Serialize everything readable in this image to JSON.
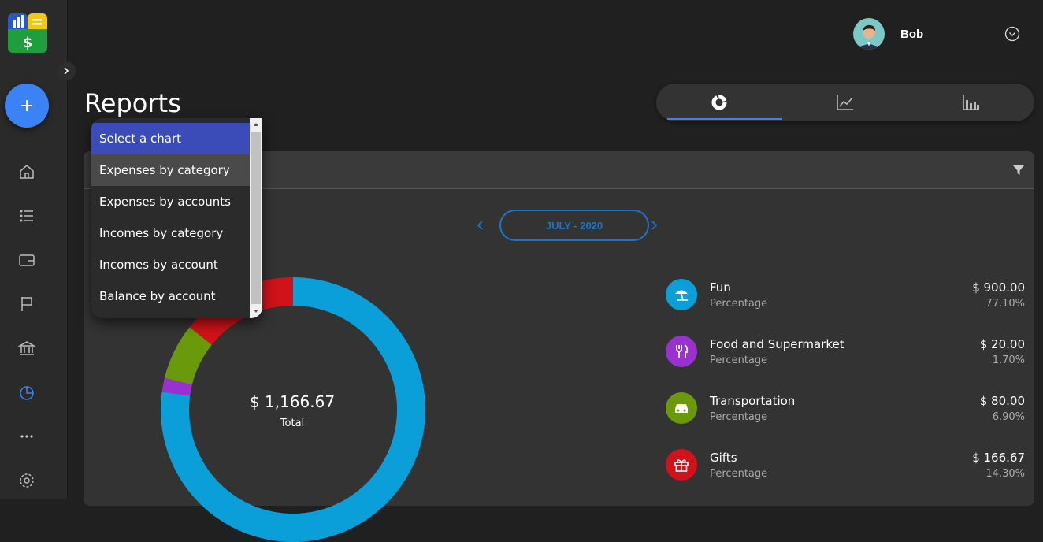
{
  "user": {
    "name": "Bob"
  },
  "page": {
    "title": "Reports"
  },
  "month": {
    "label": "JULY - 2020"
  },
  "total": {
    "amount": "$ 1,166.67",
    "label": "Total"
  },
  "dropdown": {
    "options": [
      "Select a chart",
      "Expenses by category",
      "Expenses by accounts",
      "Incomes by category",
      "Incomes by account",
      "Balance by account"
    ]
  },
  "legend": [
    {
      "name": "Fun",
      "sub": "Percentage",
      "amount": "$ 900.00",
      "pct": "77.10%",
      "color": "#0b9fd9",
      "icon": "beach-umbrella-icon"
    },
    {
      "name": "Food and Supermarket",
      "sub": "Percentage",
      "amount": "$ 20.00",
      "pct": "1.70%",
      "color": "#9b30d0",
      "icon": "restaurant-icon"
    },
    {
      "name": "Transportation",
      "sub": "Percentage",
      "amount": "$ 80.00",
      "pct": "6.90%",
      "color": "#6a9a0c",
      "icon": "car-icon"
    },
    {
      "name": "Gifts",
      "sub": "Percentage",
      "amount": "$ 166.67",
      "pct": "14.30%",
      "color": "#d0121a",
      "icon": "gift-icon"
    }
  ],
  "chart_data": {
    "type": "pie",
    "categories": [
      "Fun",
      "Food and Supermarket",
      "Transportation",
      "Gifts"
    ],
    "values": [
      900.0,
      20.0,
      80.0,
      166.67
    ],
    "colors": [
      "#0b9fd9",
      "#9b30d0",
      "#6a9a0c",
      "#d0121a"
    ]
  }
}
